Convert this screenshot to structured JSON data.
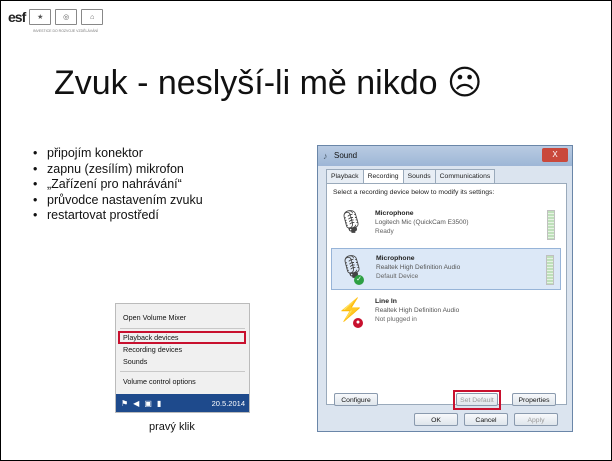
{
  "header": {
    "logo_main": "esf",
    "logo_sub": "INVESTICE DO ROZVOJE VZDĚLÁVÁNÍ"
  },
  "slide": {
    "title": "Zvuk - neslyší-li mě nikdo",
    "title_symbol": "☹",
    "bullets": [
      "připojím konektor",
      "zapnu (zesílím) mikrofon",
      "„Zařízení pro nahrávání“",
      "průvodce nastavením zvuku",
      "restartovat prostředí"
    ],
    "caption": "pravý klik"
  },
  "context_menu": {
    "items": [
      "Open Volume Mixer",
      "Playback devices",
      "Recording devices",
      "Sounds",
      "Volume control options"
    ],
    "highlight_color": "#c8102e",
    "taskbar_date": "20.5.2014"
  },
  "sound_dialog": {
    "title": "Sound",
    "close_label": "X",
    "tabs": [
      "Playback",
      "Recording",
      "Sounds",
      "Communications"
    ],
    "active_tab": "Recording",
    "instruction": "Select a recording device below to modify its settings:",
    "devices": [
      {
        "name": "Microphone",
        "description": "Logitech Mic (QuickCam E3500)",
        "status": "Ready",
        "icon": "microphone-icon"
      },
      {
        "name": "Microphone",
        "description": "Realtek High Definition Audio",
        "status": "Default Device",
        "icon": "microphone-icon",
        "badge": "✓",
        "badge_color": "#2ea043"
      },
      {
        "name": "Line In",
        "description": "Realtek High Definition Audio",
        "status": "Not plugged in",
        "icon": "line-in-icon",
        "badge": "●",
        "badge_color": "#c8102e"
      }
    ],
    "buttons": {
      "configure": "Configure",
      "set_default": "Set Default",
      "properties": "Properties",
      "ok": "OK",
      "cancel": "Cancel",
      "apply": "Apply"
    }
  }
}
